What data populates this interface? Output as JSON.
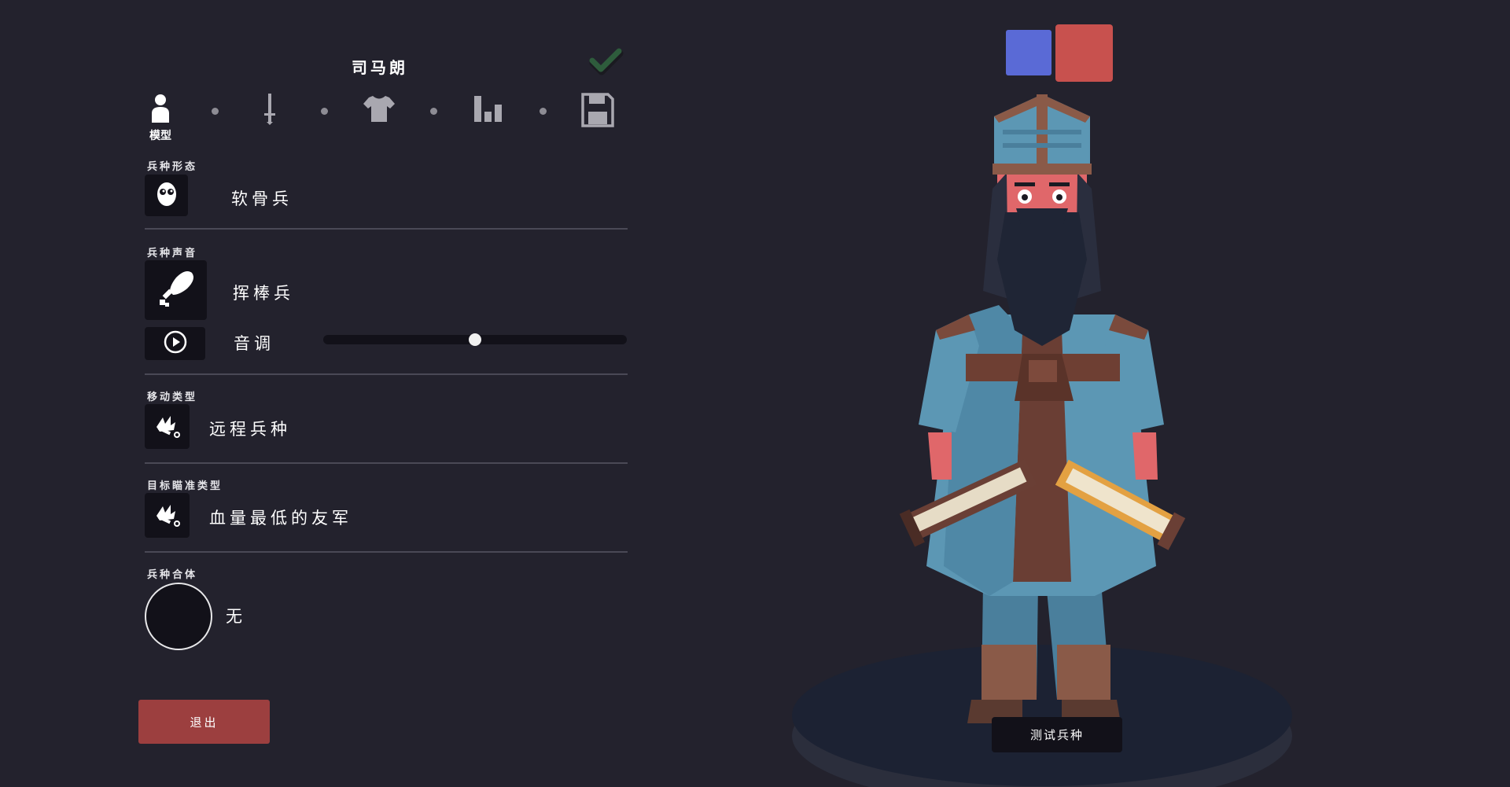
{
  "header": {
    "unit_name": "司马朗"
  },
  "tabs": [
    {
      "id": "model",
      "label": "模型",
      "icon": "person-icon",
      "active": true
    },
    {
      "id": "weapons",
      "label": "",
      "icon": "sword-icon",
      "active": false
    },
    {
      "id": "clothing",
      "label": "",
      "icon": "shirt-icon",
      "active": false
    },
    {
      "id": "stats",
      "label": "",
      "icon": "bar-chart-icon",
      "active": false
    },
    {
      "id": "save",
      "label": "",
      "icon": "floppy-disk-icon",
      "active": false
    }
  ],
  "sections": {
    "unit_form": {
      "label": "兵种形态",
      "value": "软骨兵",
      "icon": "skull-face-icon"
    },
    "unit_voice": {
      "label": "兵种声音",
      "value": "挥棒兵",
      "icon": "club-weapon-icon"
    },
    "pitch": {
      "label": "音调",
      "icon": "play-icon",
      "level": 0.5
    },
    "movement": {
      "label": "移动类型",
      "value": "远程兵种",
      "icon": "fallen-unit-icon"
    },
    "targeting": {
      "label": "目标瞄准类型",
      "value": "血量最低的友军",
      "icon": "fallen-unit-icon"
    },
    "combine": {
      "label": "兵种合体",
      "value": "无"
    }
  },
  "buttons": {
    "exit": "退出",
    "test": "测试兵种"
  },
  "team_colors": {
    "blue": "#5a6ad6",
    "red": "#c8514e"
  }
}
